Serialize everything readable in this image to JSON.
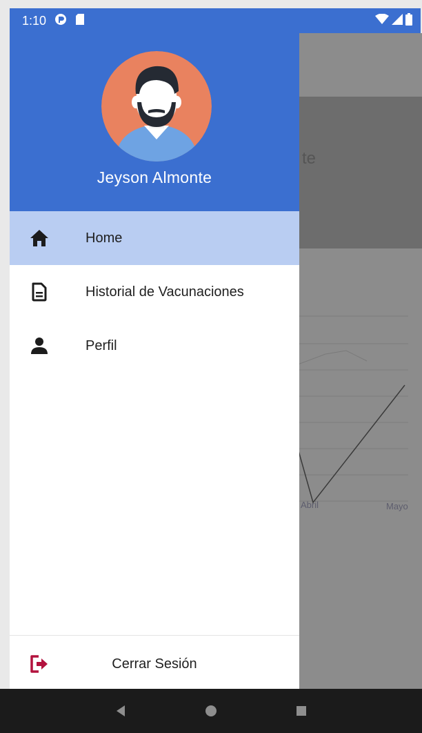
{
  "status_bar": {
    "time": "1:10"
  },
  "drawer": {
    "user_name": "Jeyson Almonte",
    "menu": [
      {
        "label": "Home",
        "icon": "home-icon",
        "active": true
      },
      {
        "label": "Historial de Vacunaciones",
        "icon": "document-icon",
        "active": false
      },
      {
        "label": "Perfil",
        "icon": "person-icon",
        "active": false
      }
    ],
    "logout_label": "Cerrar Sesión",
    "logout_icon": "logout-icon"
  },
  "background_app": {
    "title_fragment": "te",
    "chart_labels": [
      "Abril",
      "Mayo"
    ]
  },
  "colors": {
    "header_blue": "#3b6fd0",
    "active_item": "#b9cdf2",
    "logout_accent": "#b3123e",
    "avatar_bg": "#e9825f"
  }
}
